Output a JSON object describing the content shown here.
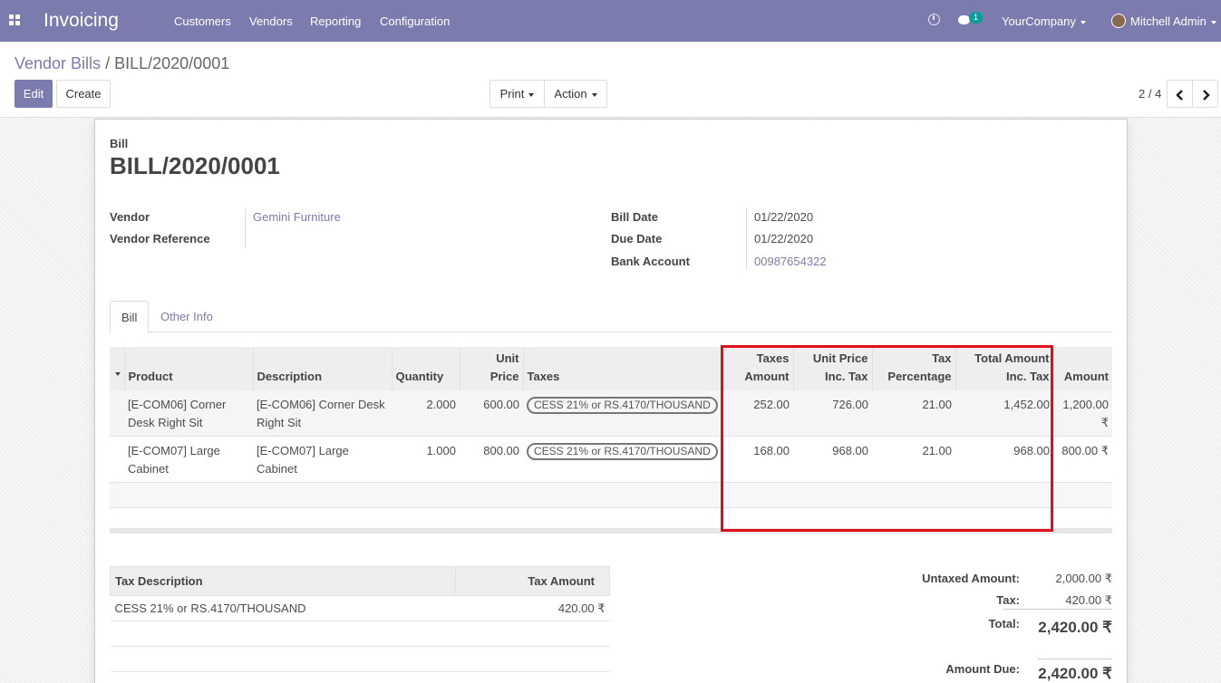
{
  "nav": {
    "app_title": "Invoicing",
    "menu": [
      "Customers",
      "Vendors",
      "Reporting",
      "Configuration"
    ],
    "message_count": "1",
    "company": "YourCompany",
    "user": "Mitchell Admin"
  },
  "breadcrumb": {
    "parent": "Vendor Bills",
    "sep": "/",
    "current": "BILL/2020/0001"
  },
  "toolbar": {
    "edit": "Edit",
    "create": "Create",
    "print": "Print",
    "action": "Action",
    "pager": "2 / 4"
  },
  "bill": {
    "type_label": "Bill",
    "number": "BILL/2020/0001",
    "vendor_label": "Vendor",
    "vendor": "Gemini Furniture",
    "vendor_ref_label": "Vendor Reference",
    "vendor_ref": "",
    "bill_date_label": "Bill Date",
    "bill_date": "01/22/2020",
    "due_date_label": "Due Date",
    "due_date": "01/22/2020",
    "bank_label": "Bank Account",
    "bank": "00987654322"
  },
  "tabs": [
    "Bill",
    "Other Info"
  ],
  "lines": {
    "headers": {
      "product": "Product",
      "description": "Description",
      "quantity": "Quantity",
      "unit_price": [
        "Unit",
        "Price"
      ],
      "taxes": "Taxes",
      "taxes_amount": [
        "Taxes",
        "Amount"
      ],
      "unit_price_inc": [
        "Unit Price",
        "Inc. Tax"
      ],
      "tax_pct": [
        "Tax",
        "Percentage"
      ],
      "total_inc": [
        "Total Amount",
        "Inc. Tax"
      ],
      "amount": "Amount"
    },
    "rows": [
      {
        "product": [
          "[E-COM06] Corner",
          "Desk Right Sit"
        ],
        "description": [
          "[E-COM06] Corner Desk",
          "Right Sit"
        ],
        "quantity": "2.000",
        "unit_price": "600.00",
        "tax": "CESS 21% or RS.4170/THOUSAND",
        "taxes_amount": "252.00",
        "unit_price_inc": "726.00",
        "tax_pct": "21.00",
        "total_inc": "1,452.00",
        "amount": "1,200.00 ₹"
      },
      {
        "product": [
          "[E-COM07] Large",
          "Cabinet"
        ],
        "description": [
          "[E-COM07] Large",
          "Cabinet"
        ],
        "quantity": "1.000",
        "unit_price": "800.00",
        "tax": "CESS 21% or RS.4170/THOUSAND",
        "taxes_amount": "168.00",
        "unit_price_inc": "968.00",
        "tax_pct": "21.00",
        "total_inc": "968.00",
        "amount": "800.00 ₹"
      }
    ]
  },
  "tax_table": {
    "headers": {
      "description": "Tax Description",
      "amount": "Tax Amount"
    },
    "rows": [
      {
        "description": "CESS 21% or RS.4170/THOUSAND",
        "amount": "420.00 ₹"
      }
    ]
  },
  "totals": {
    "untaxed_label": "Untaxed Amount:",
    "untaxed": "2,000.00 ₹",
    "tax_label": "Tax:",
    "tax": "420.00 ₹",
    "total_label": "Total:",
    "total": "2,420.00 ₹",
    "due_label": "Amount Due:",
    "due": "2,420.00 ₹"
  },
  "colors": {
    "brand": "#7c7bad",
    "highlight": "#e0101a",
    "badge": "#00a09d"
  }
}
